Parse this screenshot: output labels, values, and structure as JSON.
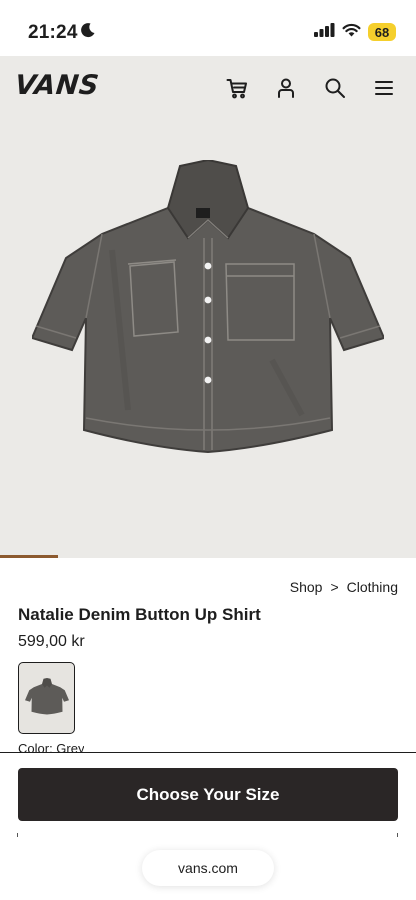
{
  "status_bar": {
    "time": "21:24",
    "battery": "68",
    "icons": [
      "moon-icon",
      "cellular-signal-icon",
      "wifi-icon",
      "battery-icon"
    ]
  },
  "header": {
    "logo": "VANS",
    "icons": [
      "cart-icon",
      "account-icon",
      "search-icon",
      "menu-icon"
    ]
  },
  "gallery": {
    "image": "grey denim short-sleeve button up shirt",
    "progress": 0.14,
    "accent": "#8c5a2f",
    "background": "#ebeae7"
  },
  "breadcrumb": {
    "items": [
      "Shop",
      "Clothing"
    ],
    "separator": ">"
  },
  "product": {
    "title": "Natalie Denim Button Up Shirt",
    "price": "599,00 kr",
    "color_label": "Color: Grey"
  },
  "cta": {
    "label": "Choose Your Size",
    "color": "#2a2626"
  },
  "browser": {
    "url": "vans.com"
  }
}
